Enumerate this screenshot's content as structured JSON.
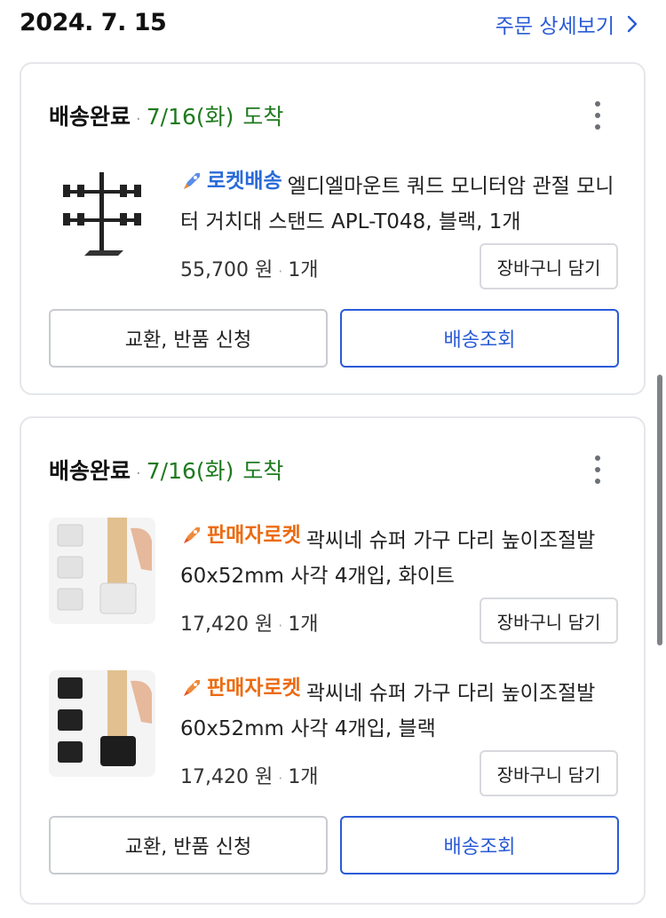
{
  "header": {
    "order_date": "2024. 7. 15",
    "detail_link_label": "주문 상세보기"
  },
  "orders": [
    {
      "status": "배송완료",
      "separator": "·",
      "arrival_date": "7/16(화)",
      "arrival_word": "도착",
      "items": [
        {
          "badge": "로켓배송",
          "badge_color": "#2a6bd8",
          "title": "엘디엘마운트 쿼드 모니터암 관절 모니터 거치대 스탠드 APL-T048, 블랙, 1개",
          "price": "55,700 원",
          "quantity": "1개",
          "cart_label": "장바구니 담기",
          "thumbnail_icon": "monitor-arm-stand-image"
        }
      ],
      "return_label": "교환, 반품 신청",
      "track_label": "배송조회"
    },
    {
      "status": "배송완료",
      "separator": "·",
      "arrival_date": "7/16(화)",
      "arrival_word": "도착",
      "items": [
        {
          "badge": "판매자로켓",
          "badge_color": "#ec6b12",
          "title": "곽씨네 슈퍼 가구 다리 높이조절발 60x52mm 사각 4개입, 화이트",
          "price": "17,420 원",
          "quantity": "1개",
          "cart_label": "장바구니 담기",
          "thumbnail_icon": "white-leg-caps-image"
        },
        {
          "badge": "판매자로켓",
          "badge_color": "#ec6b12",
          "title": "곽씨네 슈퍼 가구 다리 높이조절발 60x52mm 사각 4개입, 블랙",
          "price": "17,420 원",
          "quantity": "1개",
          "cart_label": "장바구니 담기",
          "thumbnail_icon": "black-leg-caps-image"
        }
      ],
      "return_label": "교환, 반품 신청",
      "track_label": "배송조회"
    }
  ],
  "colors": {
    "link_blue": "#2a5bd7",
    "arrival_green": "#1f7a1f",
    "rocket_blue": "#2a6bd8",
    "seller_orange": "#ec6b12"
  }
}
